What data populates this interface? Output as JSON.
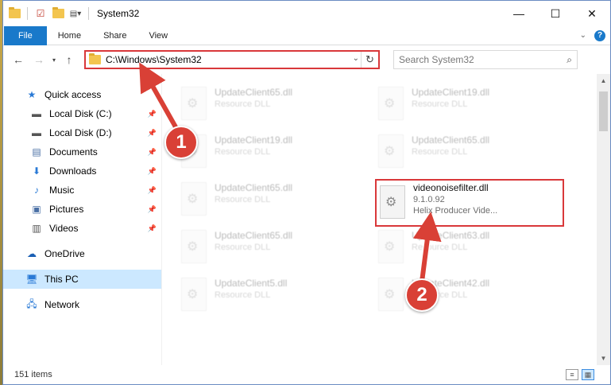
{
  "window": {
    "title": "System32",
    "caption": {
      "minimize": "—",
      "maximize": "☐",
      "close": "✕"
    }
  },
  "ribbon": {
    "tabs": [
      "File",
      "Home",
      "Share",
      "View"
    ]
  },
  "address": {
    "path": "C:\\Windows\\System32",
    "search_placeholder": "Search System32"
  },
  "sidebar": {
    "items": [
      {
        "label": "Quick access",
        "icon": "star-icon"
      },
      {
        "label": "Local Disk (C:)",
        "icon": "drive-icon",
        "pinned": true
      },
      {
        "label": "Local Disk (D:)",
        "icon": "drive-icon",
        "pinned": true
      },
      {
        "label": "Documents",
        "icon": "document-icon",
        "pinned": true
      },
      {
        "label": "Downloads",
        "icon": "download-icon",
        "pinned": true
      },
      {
        "label": "Music",
        "icon": "music-icon",
        "pinned": true
      },
      {
        "label": "Pictures",
        "icon": "pictures-icon",
        "pinned": true
      },
      {
        "label": "Videos",
        "icon": "video-icon",
        "pinned": true
      },
      {
        "label": "OneDrive",
        "icon": "cloud-icon"
      },
      {
        "label": "This PC",
        "icon": "computer-icon",
        "selected": true
      },
      {
        "label": "Network",
        "icon": "network-icon"
      }
    ]
  },
  "files": [
    {
      "name": "UpdateClient65.dll",
      "meta": "Resource DLL"
    },
    {
      "name": "UpdateClient19.dll",
      "meta": "Resource DLL"
    },
    {
      "name": "UpdateClient19.dll",
      "meta": "Resource DLL"
    },
    {
      "name": "UpdateClient65.dll",
      "meta": "Resource DLL"
    },
    {
      "name": "UpdateClient65.dll",
      "meta": "Resource DLL"
    },
    {
      "name": "videonoisefilter.dll",
      "meta": "9.1.0.92",
      "meta2": "Helix Producer Vide..."
    },
    {
      "name": "UpdateClient65.dll",
      "meta": "Resource DLL"
    },
    {
      "name": "UpdateClient63.dll",
      "meta": "Resource DLL"
    },
    {
      "name": "UpdateClient5.dll",
      "meta": "Resource DLL"
    },
    {
      "name": "UpdateClient42.dll",
      "meta": "Resource DLL"
    }
  ],
  "status": {
    "item_count": "151 items"
  },
  "annotations": [
    {
      "label": "1"
    },
    {
      "label": "2"
    }
  ],
  "colors": {
    "accent": "#1979ca",
    "highlight": "#d9383a",
    "selected": "#cce8ff"
  }
}
